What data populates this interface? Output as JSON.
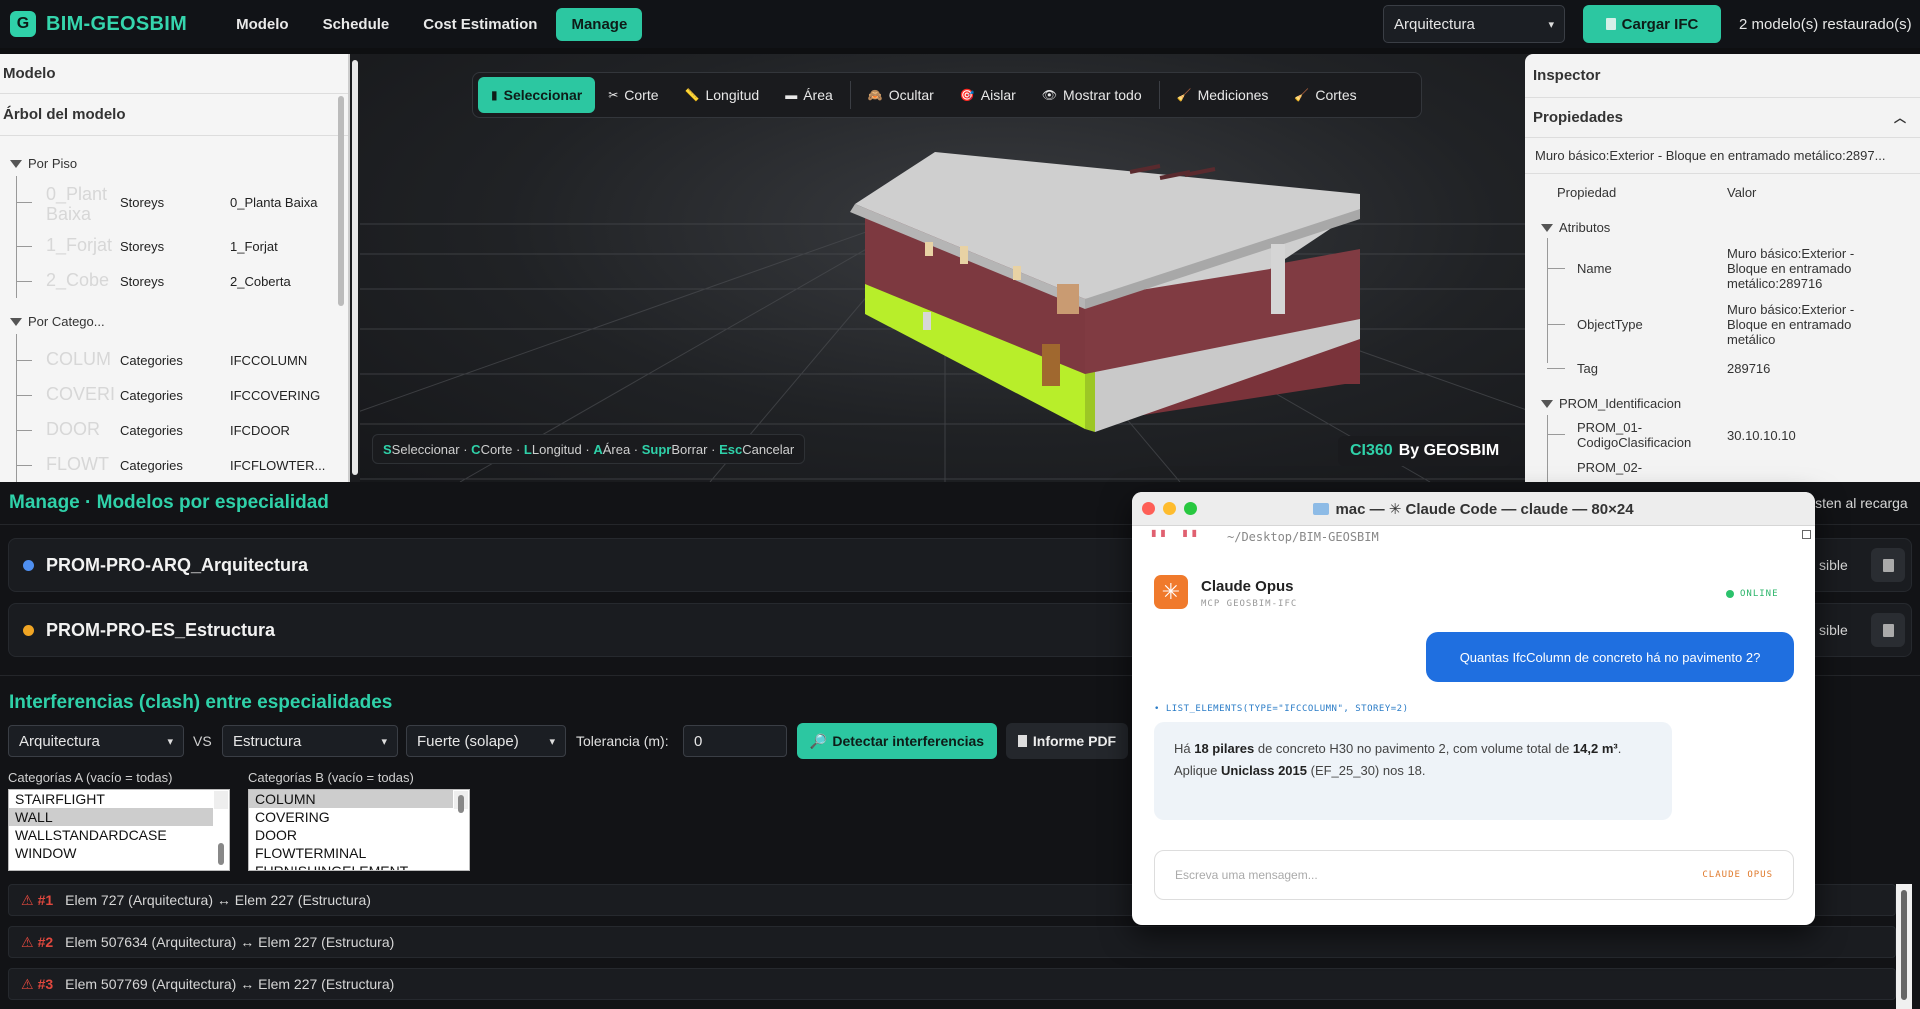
{
  "brand": {
    "logo_letter": "G",
    "name": "BIM-GEOSBIM"
  },
  "nav": [
    {
      "label": "Modelo",
      "active": false
    },
    {
      "label": "Schedule",
      "active": false
    },
    {
      "label": "Cost Estimation",
      "active": false
    },
    {
      "label": "Manage",
      "active": true
    }
  ],
  "topbar": {
    "discipline_select": "Arquitectura",
    "load_button": "Cargar IFC",
    "status": "2 modelo(s) restaurado(s)"
  },
  "left_panel": {
    "title": "Modelo",
    "tree_title": "Árbol del modelo",
    "groups": [
      {
        "label": "Por Piso",
        "rows": [
          {
            "ghost": "0_Plant Baixa",
            "col1": "Storeys",
            "col2": "0_Planta Baixa"
          },
          {
            "ghost": "1_Forjat",
            "col1": "Storeys",
            "col2": "1_Forjat"
          },
          {
            "ghost": "2_Cobe",
            "col1": "Storeys",
            "col2": "2_Coberta"
          }
        ]
      },
      {
        "label": "Por Catego...",
        "rows": [
          {
            "ghost": "COLUM",
            "col1": "Categories",
            "col2": "IFCCOLUMN"
          },
          {
            "ghost": "COVERI",
            "col1": "Categories",
            "col2": "IFCCOVERING"
          },
          {
            "ghost": "DOOR",
            "col1": "Categories",
            "col2": "IFCDOOR"
          },
          {
            "ghost": "FLOWT",
            "col1": "Categories",
            "col2": "IFCFLOWTER..."
          }
        ]
      }
    ]
  },
  "viewer": {
    "tools": [
      {
        "label": "Seleccionar",
        "icon": "cursor-icon",
        "glyph": "▮",
        "active": true
      },
      {
        "label": "Corte",
        "icon": "scissors-icon",
        "glyph": "✂",
        "active": false
      },
      {
        "label": "Longitud",
        "icon": "ruler-icon",
        "glyph": "📏",
        "active": false
      },
      {
        "label": "Área",
        "icon": "area-icon",
        "glyph": "▬",
        "active": false
      },
      {
        "label": "Ocultar",
        "icon": "hide-icon",
        "glyph": "🙈",
        "active": false
      },
      {
        "label": "Aislar",
        "icon": "isolate-icon",
        "glyph": "🎯",
        "active": false
      },
      {
        "label": "Mostrar todo",
        "icon": "eye-icon",
        "glyph": "👁",
        "active": false
      },
      {
        "label": "Mediciones",
        "icon": "measure-icon",
        "glyph": "🧹",
        "active": false
      },
      {
        "label": "Cortes",
        "icon": "sections-icon",
        "glyph": "🧹",
        "active": false
      }
    ],
    "hints": [
      {
        "key": "S",
        "text": "Seleccionar"
      },
      {
        "key": "C",
        "text": "Corte"
      },
      {
        "key": "L",
        "text": "Longitud"
      },
      {
        "key": "A",
        "text": "Área"
      },
      {
        "key": "Supr",
        "text": "Borrar"
      },
      {
        "key": "Esc",
        "text": "Cancelar"
      }
    ],
    "watermark_tag": "CI360",
    "watermark_text": "By GEOSBIM"
  },
  "inspector": {
    "title": "Inspector",
    "section": "Propiedades",
    "element": "Muro básico:Exterior - Bloque en entramado metálico:2897...",
    "col_property": "Propiedad",
    "col_value": "Valor",
    "groups": [
      {
        "label": "Atributos",
        "rows": [
          {
            "key": "Name",
            "value": "Muro básico:Exterior - Bloque en entramado metálico:289716"
          },
          {
            "key": "ObjectType",
            "value": "Muro básico:Exterior - Bloque en entramado metálico"
          },
          {
            "key": "Tag",
            "value": "289716"
          }
        ]
      },
      {
        "label": "PROM_Identificacion",
        "rows": [
          {
            "key": "PROM_01-CodigoClasificacion",
            "value": "30.10.10.10"
          },
          {
            "key": "PROM_02-",
            "value": ""
          }
        ]
      }
    ]
  },
  "manage": {
    "title": "Manage · Modelos por especialidad",
    "persist_note": "isten al recarga",
    "models": [
      {
        "name": "PROM-PRO-ARQ_Arquitectura",
        "color": "#4f8ff0",
        "visible_label": "sible"
      },
      {
        "name": "PROM-PRO-ES_Estructura",
        "color": "#f0a524",
        "visible_label": "sible"
      }
    ],
    "clash_title": "Interferencias (clash) entre especialidades",
    "discipline_a": "Arquitectura",
    "vs": "VS",
    "discipline_b": "Estructura",
    "mode": "Fuerte (solape)",
    "tolerance_label": "Tolerancia (m):",
    "tolerance_value": "0",
    "detect_button": "Detectar interferencias",
    "pdf_button": "Informe PDF",
    "cat_a_label": "Categorías A (vacío = todas)",
    "cat_b_label": "Categorías B (vacío = todas)",
    "cat_a": [
      {
        "label": "STAIRFLIGHT",
        "selected": false
      },
      {
        "label": "WALL",
        "selected": true
      },
      {
        "label": "WALLSTANDARDCASE",
        "selected": false
      },
      {
        "label": "WINDOW",
        "selected": false
      }
    ],
    "cat_b": [
      {
        "label": "COLUMN",
        "selected": true
      },
      {
        "label": "COVERING",
        "selected": false
      },
      {
        "label": "DOOR",
        "selected": false
      },
      {
        "label": "FLOWTERMINAL",
        "selected": false
      },
      {
        "label": "FURNISHINGELEMENT",
        "selected": false
      }
    ],
    "clashes": [
      {
        "num": "#1",
        "text": "Elem 727 (Arquitectura) ↔ Elem 227 (Estructura)"
      },
      {
        "num": "#2",
        "text": "Elem 507634 (Arquitectura) ↔ Elem 227 (Estructura)"
      },
      {
        "num": "#3",
        "text": "Elem 507769 (Arquitectura) ↔ Elem 227 (Estructura)"
      }
    ]
  },
  "terminal": {
    "title": "mac — ✳ Claude Code — claude — 80×24",
    "marks": "▘▘ ▝▝",
    "path": "~/Desktop/BIM-GEOSBIM",
    "assistant_name": "Claude Opus",
    "assistant_sub": "MCP GEOSBIM-IFC",
    "status": "ONLINE",
    "user_message": "Quantas IfcColumn de concreto há no pavimento 2?",
    "tool_call": "• LIST_ELEMENTS(TYPE=\"IFCCOLUMN\", STOREY=2)",
    "reply_pre": "Há ",
    "reply_b1": "18 pilares",
    "reply_mid1": " de concreto H30 no pavimento 2, com volume total de ",
    "reply_b2": "14,2 m³",
    "reply_mid2": ". Aplique ",
    "reply_b3": "Uniclass 2015",
    "reply_post": " (EF_25_30) nos 18.",
    "input_placeholder": "Escreva uma mensagem...",
    "input_model": "CLAUDE OPUS"
  }
}
